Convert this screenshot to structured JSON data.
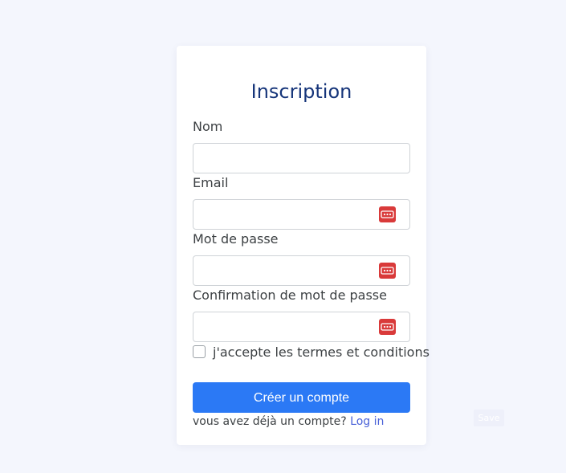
{
  "form": {
    "title": "Inscription",
    "fields": [
      {
        "label": "Nom",
        "value": "",
        "has_password_icon": false
      },
      {
        "label": "Email",
        "value": "",
        "has_password_icon": true
      },
      {
        "label": "Mot de passe",
        "value": "",
        "has_password_icon": true
      },
      {
        "label": "Confirmation de mot de passe",
        "value": "",
        "has_password_icon": true
      }
    ],
    "terms_label": "j'accepte les termes et conditions",
    "terms_checked": false,
    "submit_label": "Créer un compte",
    "login_prompt": "vous avez déjà un compte?",
    "login_link": "Log in"
  },
  "save_label": "Save",
  "colors": {
    "background": "#f4f6fd",
    "title": "#16357a",
    "primary_button": "#2b79f5",
    "link": "#4961d8",
    "password_icon": "#d93a3a"
  },
  "icons": {
    "password_manager": "password-key-icon"
  }
}
